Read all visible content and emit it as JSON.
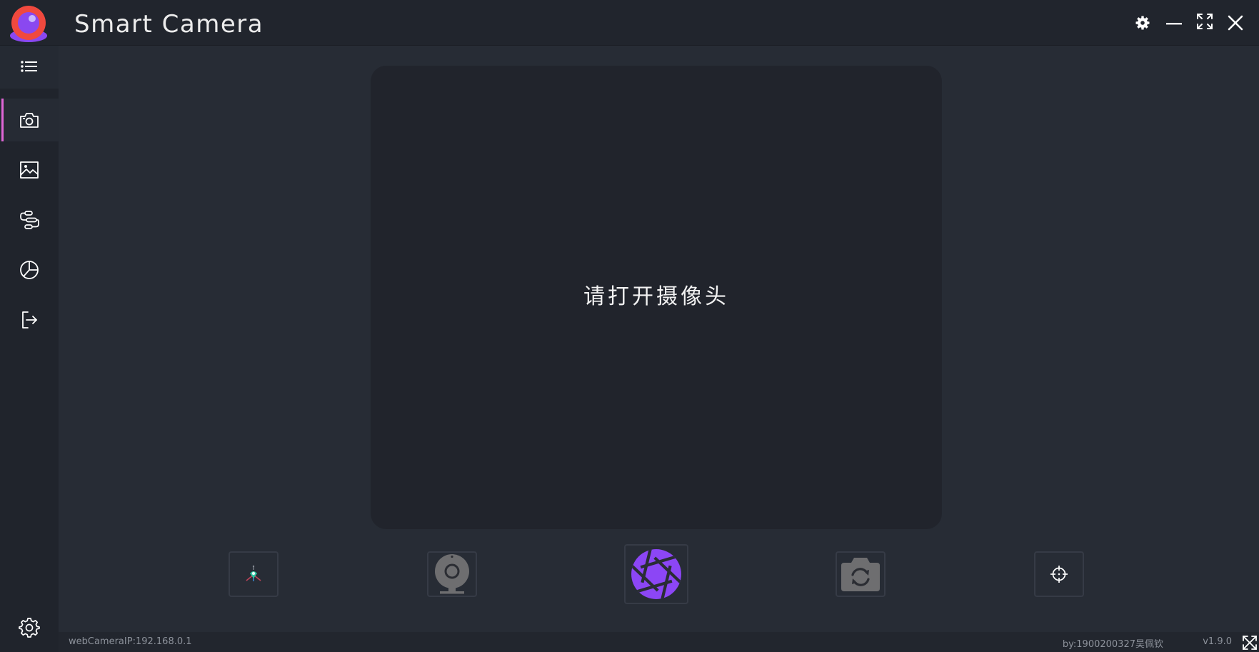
{
  "titlebar": {
    "app_title": "Smart Camera",
    "logo_icon": "app-logo",
    "buttons": [
      {
        "name": "settings",
        "icon": "gear-icon"
      },
      {
        "name": "minimize",
        "icon": "minimize-icon"
      },
      {
        "name": "maximize",
        "icon": "maximize-icon"
      },
      {
        "name": "close",
        "icon": "close-icon"
      }
    ]
  },
  "sidebar": {
    "menu_icon": "list-icon",
    "items": [
      {
        "id": "camera",
        "icon": "camera-icon",
        "active": true
      },
      {
        "id": "gallery",
        "icon": "image-icon",
        "active": false
      },
      {
        "id": "flow",
        "icon": "flow-icon",
        "active": false
      },
      {
        "id": "statistics",
        "icon": "pie-chart-icon",
        "active": false
      },
      {
        "id": "logout",
        "icon": "logout-icon",
        "active": false
      }
    ],
    "settings_icon": "gear-icon",
    "active_color": "#e066d6"
  },
  "preview": {
    "placeholder": "请打开摄像头"
  },
  "controls": [
    {
      "id": "locate",
      "icon": "location-pin-icon"
    },
    {
      "id": "webcam",
      "icon": "webcam-icon"
    },
    {
      "id": "shutter",
      "icon": "shutter-icon",
      "accent": "#8c46f5"
    },
    {
      "id": "switch-camera",
      "icon": "camera-switch-icon"
    },
    {
      "id": "crosshair",
      "icon": "crosshair-icon"
    }
  ],
  "statusbar": {
    "ip": "webCameraIP:192.168.0.1",
    "author": "by:1900200327吴佩钦",
    "version": "v1.9.0"
  },
  "colors": {
    "background": "#272c35",
    "titlebar": "#21252d",
    "sidebar": "#20242c",
    "preview": "#21242c",
    "accent": "#8c46f5"
  }
}
